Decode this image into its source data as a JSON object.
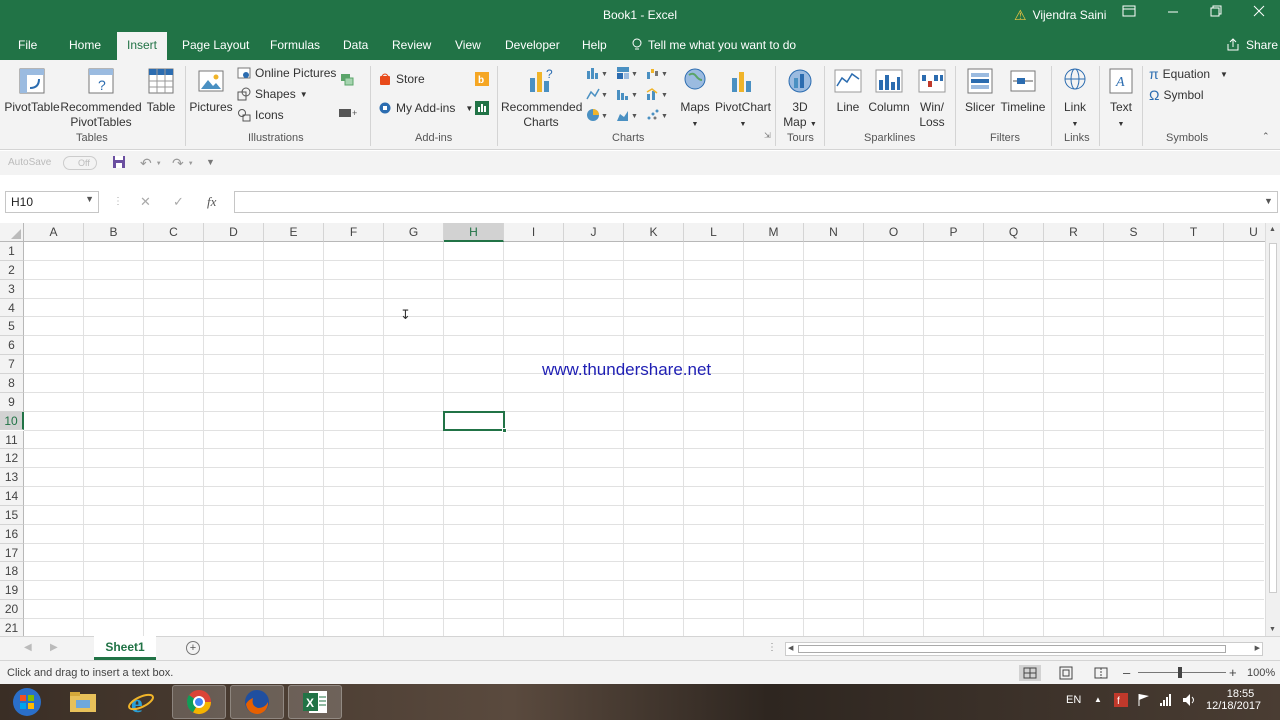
{
  "window": {
    "title": "Book1  -  Excel",
    "user": "Vijendra Saini",
    "controls": [
      "ribbon-display",
      "minimize",
      "restore",
      "close"
    ]
  },
  "menu": {
    "tabs": [
      "File",
      "Home",
      "Insert",
      "Page Layout",
      "Formulas",
      "Data",
      "Review",
      "View",
      "Developer",
      "Help"
    ],
    "active_tab": "Insert",
    "tell_me": "Tell me what you want to do",
    "share": "Share"
  },
  "ribbon": {
    "groups": {
      "tables": "Tables",
      "illustrations": "Illustrations",
      "addins": "Add-ins",
      "charts": "Charts",
      "tours": "Tours",
      "sparklines": "Sparklines",
      "filters": "Filters",
      "links": "Links",
      "symbols": "Symbols"
    },
    "buttons": {
      "pivottable": "PivotTable",
      "recommended_pivottables_1": "Recommended",
      "recommended_pivottables_2": "PivotTables",
      "table": "Table",
      "pictures": "Pictures",
      "online_pictures": "Online Pictures",
      "shapes": "Shapes",
      "icons": "Icons",
      "store": "Store",
      "my_addins": "My Add-ins",
      "recommended_charts_1": "Recommended",
      "recommended_charts_2": "Charts",
      "maps": "Maps",
      "pivotchart": "PivotChart",
      "map3d_1": "3D",
      "map3d_2": "Map",
      "line": "Line",
      "column": "Column",
      "winloss_1": "Win/",
      "winloss_2": "Loss",
      "slicer": "Slicer",
      "timeline": "Timeline",
      "link": "Link",
      "text": "Text",
      "equation": "Equation",
      "symbol": "Symbol"
    }
  },
  "qat": {
    "autosave": "AutoSave",
    "autosave_state": "Off"
  },
  "formula_bar": {
    "name_box": "H10",
    "fx": "fx",
    "value": ""
  },
  "sheet": {
    "columns": [
      "A",
      "B",
      "C",
      "D",
      "E",
      "F",
      "G",
      "H",
      "I",
      "J",
      "K",
      "L",
      "M",
      "N",
      "O",
      "P",
      "Q",
      "R",
      "S",
      "T",
      "U"
    ],
    "rows": [
      "1",
      "2",
      "3",
      "4",
      "5",
      "6",
      "7",
      "8",
      "9",
      "10",
      "11",
      "12",
      "13",
      "14",
      "15",
      "16",
      "17",
      "18",
      "19",
      "20",
      "21"
    ],
    "selected_column": "H",
    "selected_row": "10",
    "watermark": "www.thundershare.net"
  },
  "sheet_tabs": {
    "tabs": [
      "Sheet1"
    ],
    "active": "Sheet1"
  },
  "status_bar": {
    "message": "Click and drag to insert a text box.",
    "zoom": "100%"
  },
  "taskbar": {
    "apps": [
      "start",
      "file-explorer",
      "internet-explorer",
      "chrome",
      "firefox",
      "excel"
    ],
    "language": "EN",
    "time": "18:55",
    "date": "12/18/2017"
  },
  "colors": {
    "excel_green": "#217346",
    "ribbon_bg": "#f3f3f3",
    "watermark": "#1f1fb4"
  }
}
